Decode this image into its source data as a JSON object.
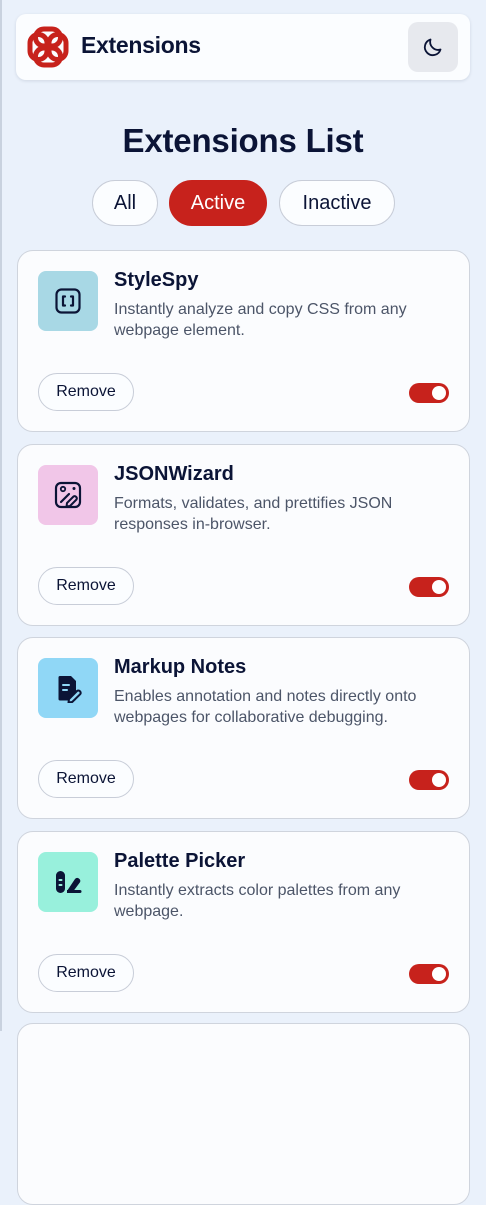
{
  "header": {
    "brand": "Extensions",
    "logo_icon": "logo-icon",
    "theme_icon": "moon-icon"
  },
  "list_title": "Extensions List",
  "filters": {
    "all": "All",
    "active": "Active",
    "inactive": "Inactive",
    "selected": "Active"
  },
  "colors": {
    "accent": "#c7221c",
    "background": "#eaf1fb",
    "card": "#fbfcfe",
    "text": "#0b1436"
  },
  "extensions": [
    {
      "name": "StyleSpy",
      "description": "Instantly analyze and copy CSS from any webpage element.",
      "icon": "brackets-icon",
      "icon_bg": "#a8d8e5",
      "remove_label": "Remove",
      "enabled": true
    },
    {
      "name": "JSONWizard",
      "description": "Formats, validates, and prettifies JSON responses in-browser.",
      "icon": "magic-image-icon",
      "icon_bg": "#f1c6e8",
      "remove_label": "Remove",
      "enabled": true
    },
    {
      "name": "Markup Notes",
      "description": "Enables annotation and notes directly onto webpages for collaborative debugging.",
      "icon": "note-pen-icon",
      "icon_bg": "#90d7f6",
      "remove_label": "Remove",
      "enabled": true
    },
    {
      "name": "Palette Picker",
      "description": "Instantly extracts color palettes from any webpage.",
      "icon": "palette-icon",
      "icon_bg": "#98f0dc",
      "remove_label": "Remove",
      "enabled": true
    }
  ]
}
